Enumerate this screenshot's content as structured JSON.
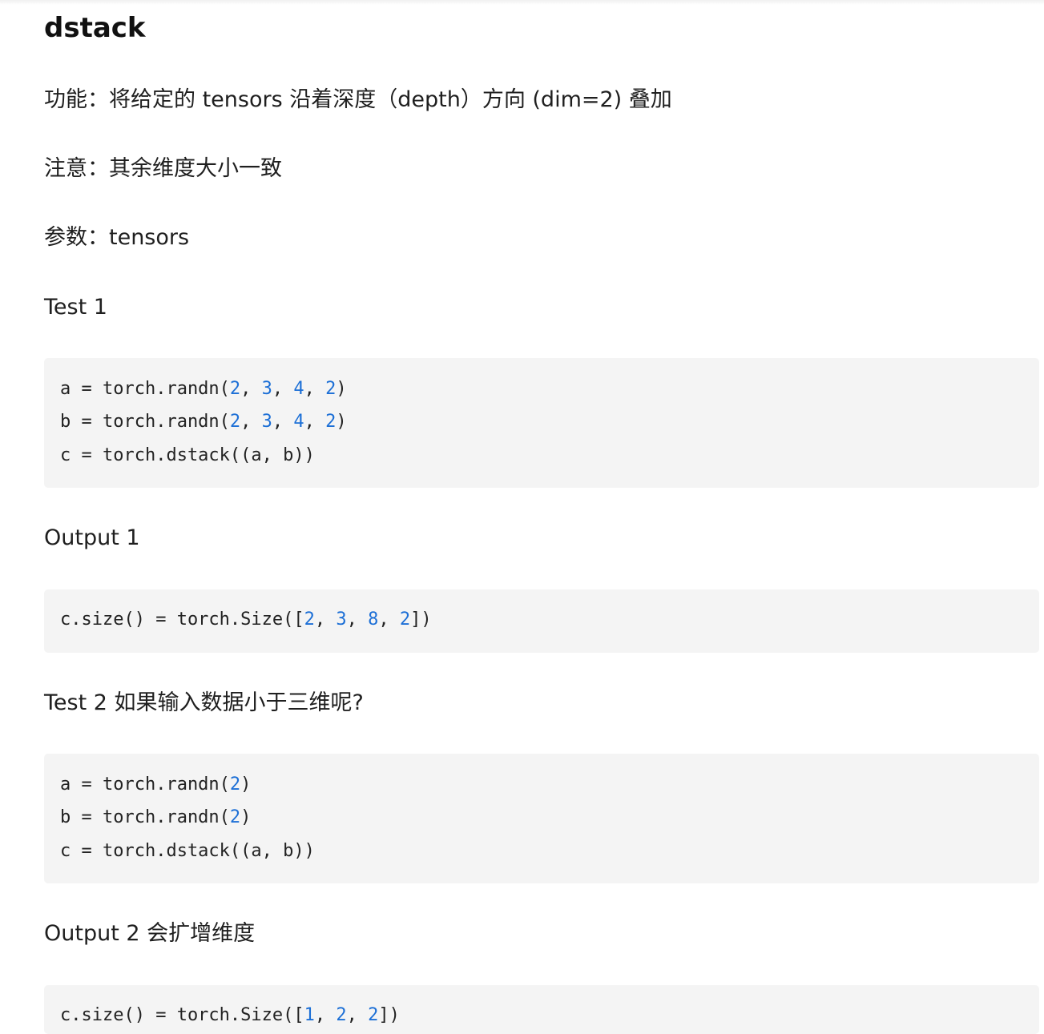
{
  "title": "dstack",
  "paragraphs": {
    "function": "功能：将给定的 tensors 沿着深度（depth）方向 (dim=2) 叠加",
    "note": "注意：其余维度大小一致",
    "params": "参数：tensors",
    "test1": "Test 1",
    "output1": "Output 1",
    "test2": "Test 2 如果输入数据小于三维呢?",
    "output2": "Output 2 会扩增维度"
  },
  "code": {
    "test1": [
      [
        "a = torch.randn(",
        "2",
        ", ",
        "3",
        ", ",
        "4",
        ", ",
        "2",
        ")"
      ],
      [
        "b = torch.randn(",
        "2",
        ", ",
        "3",
        ", ",
        "4",
        ", ",
        "2",
        ")"
      ],
      [
        "c = torch.dstack((a, b))"
      ]
    ],
    "output1": [
      [
        "c.size() = torch.Size([",
        "2",
        ", ",
        "3",
        ", ",
        "8",
        ", ",
        "2",
        "])"
      ]
    ],
    "test2": [
      [
        "a = torch.randn(",
        "2",
        ")"
      ],
      [
        "b = torch.randn(",
        "2",
        ")"
      ],
      [
        "c = torch.dstack((a, b))"
      ]
    ],
    "output2": [
      [
        "c.size() = torch.Size([",
        "1",
        ", ",
        "2",
        ", ",
        "2",
        "])"
      ]
    ]
  },
  "colors": {
    "number": "#1c6fd6",
    "code_background": "#f4f4f4"
  }
}
